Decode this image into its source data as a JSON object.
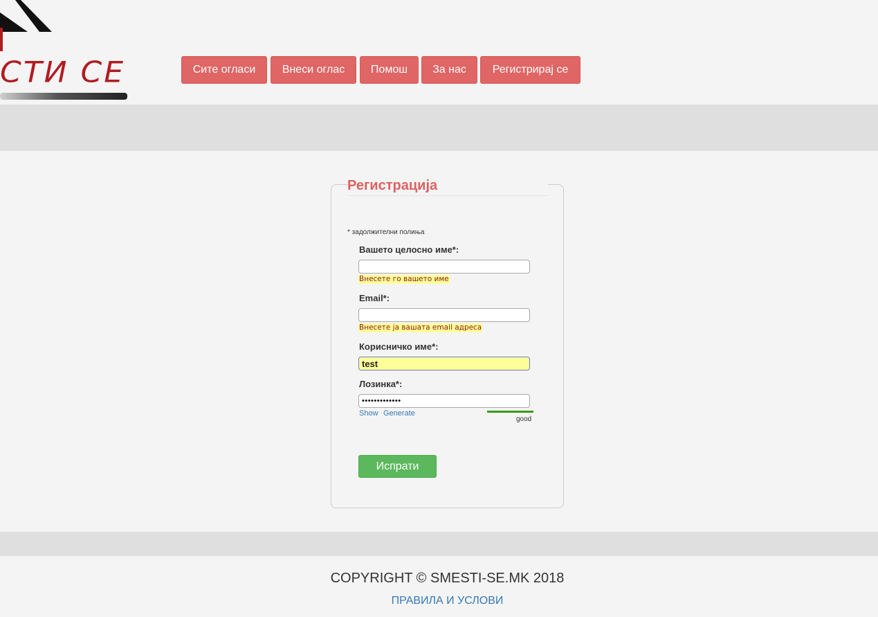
{
  "header": {
    "logo_text": "СТИ СЕ"
  },
  "nav": {
    "items": [
      {
        "label": "Сите огласи"
      },
      {
        "label": "Внеси оглас"
      },
      {
        "label": "Помош"
      },
      {
        "label": "За нас"
      },
      {
        "label": "Регистрирај се"
      }
    ],
    "button_color": "#e06565"
  },
  "form": {
    "title": "Регистрација",
    "required_note": "* задолжителни полиња",
    "fields": {
      "fullname": {
        "label": "Вашето целосно име*:",
        "value": "",
        "error": "Внесете го вашето име"
      },
      "email": {
        "label": "Email*:",
        "value": "",
        "error": "Внесете ја вашата email адреса"
      },
      "username": {
        "label": "Корисничко име*:",
        "value": "test"
      },
      "password": {
        "label": "Лозинка*:",
        "value": "•••••••••••••",
        "show_link": "Show",
        "generate_link": "Generate",
        "strength": "good"
      }
    },
    "submit_label": "Испрати",
    "title_color": "#dd6161",
    "submit_color": "#5cb85c"
  },
  "footer": {
    "copyright": "COPYRIGHT © SMESTI-SE.MK 2018",
    "terms_link": "ПРАВИЛА И УСЛОВИ"
  }
}
